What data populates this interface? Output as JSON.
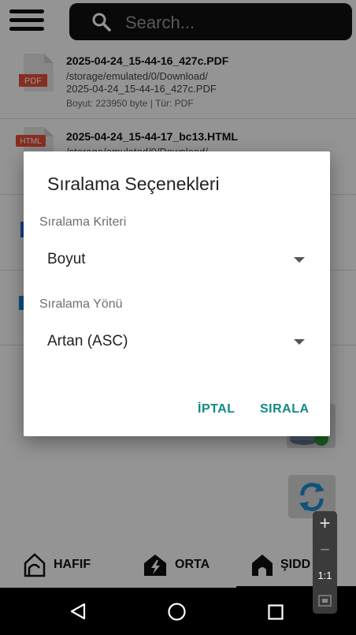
{
  "search": {
    "placeholder": "Search..."
  },
  "files": [
    {
      "name": "2025-04-24_15-44-16_427c.PDF",
      "path_line1": "/storage/emulated/0/Download/",
      "path_line2": "2025-04-24_15-44-16_427c.PDF",
      "meta": "Boyut: 223950 byte | Tür: PDF",
      "icon_label": "PDF",
      "icon_color": "#e8503a"
    },
    {
      "name": "2025-04-24_15-44-17_bc13.HTML",
      "path_line1": "/storage/emulated/0/Download/",
      "icon_label": "HTML",
      "icon_color": "#e8503a"
    }
  ],
  "bottom_nav": {
    "items": [
      {
        "label": "HAFIF"
      },
      {
        "label": "ORTA"
      },
      {
        "label": "ŞIDD"
      }
    ]
  },
  "zoom": {
    "ratio": "1:1"
  },
  "dialog": {
    "title": "Sıralama Seçenekleri",
    "criteria_label": "Sıralama Kriteri",
    "criteria_value": "Boyut",
    "direction_label": "Sıralama Yönü",
    "direction_value": "Artan (ASC)",
    "cancel_label": "İPTAL",
    "sort_label": "SIRALA",
    "accent_color": "#138a86"
  }
}
